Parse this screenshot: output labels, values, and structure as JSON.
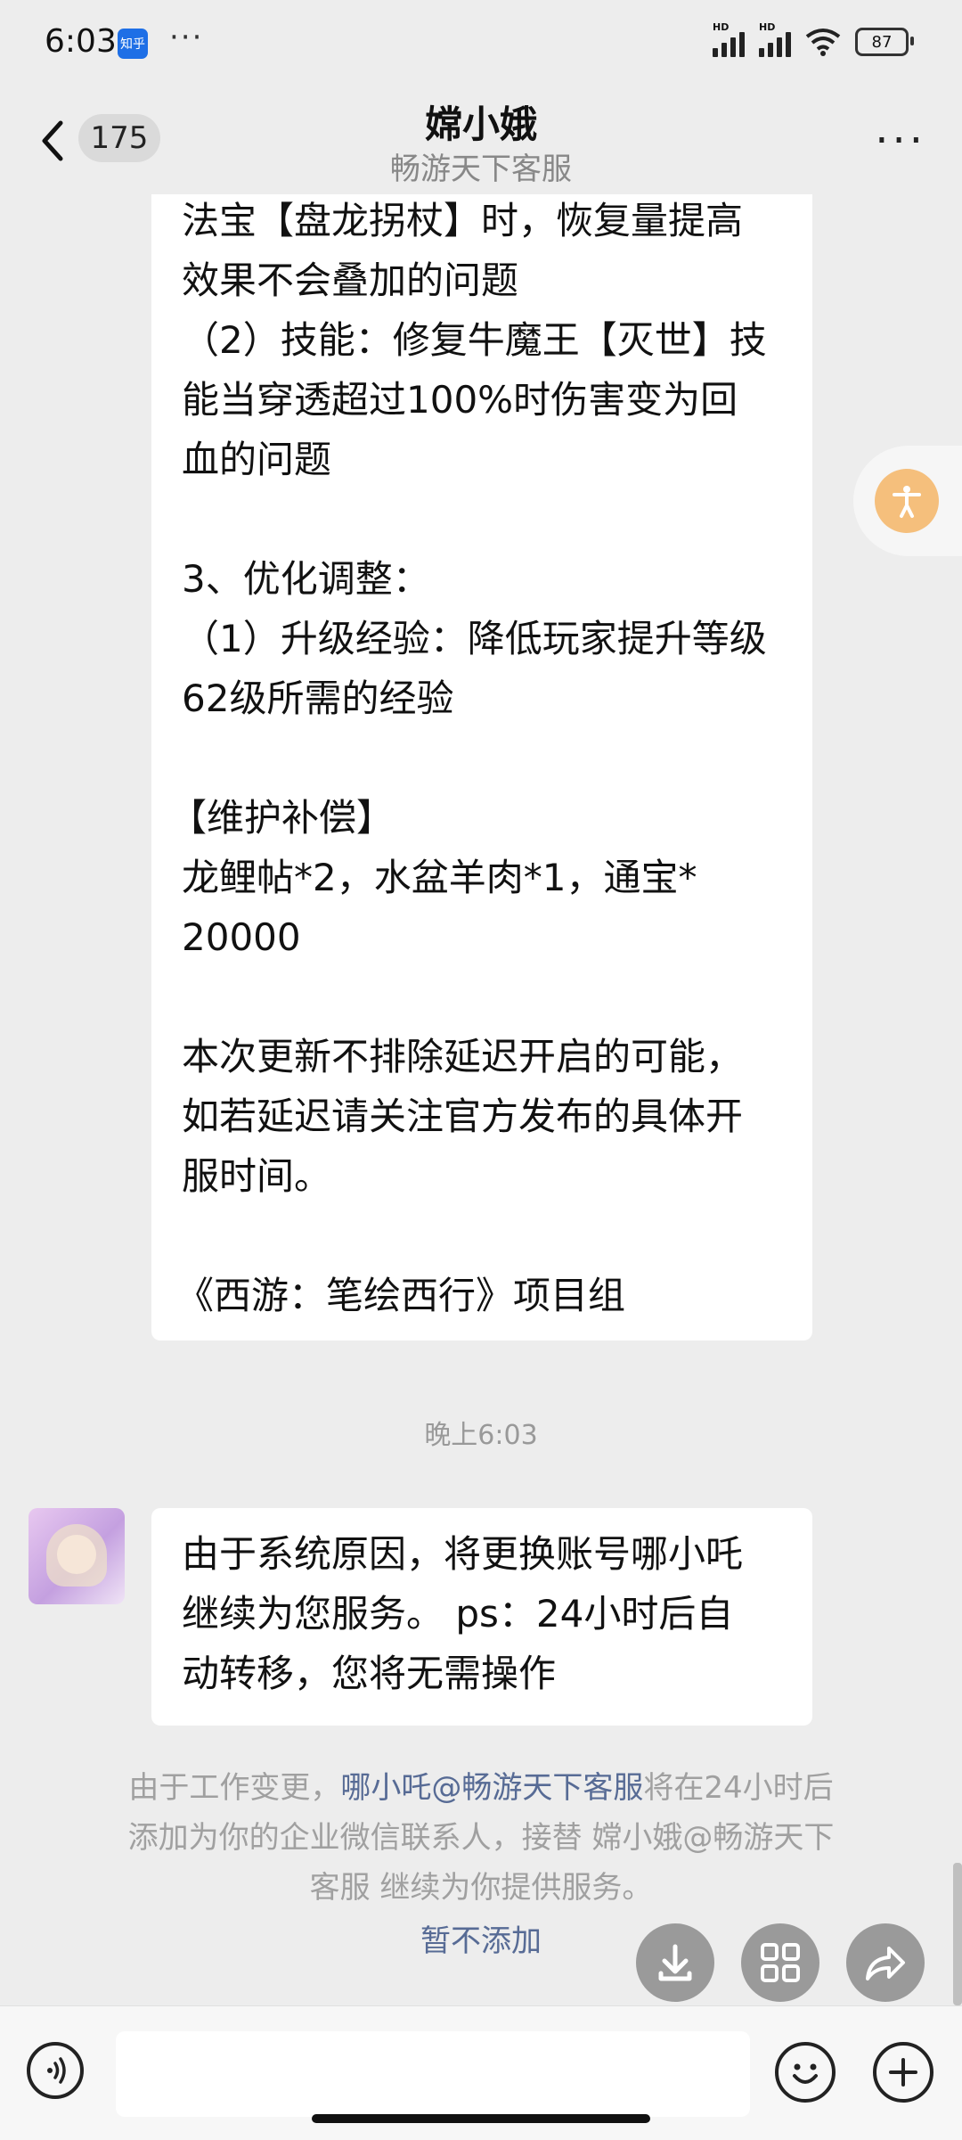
{
  "status_bar": {
    "time": "6:03",
    "app_badge": "知乎",
    "dots": "···",
    "hd": "HD",
    "battery": "87"
  },
  "header": {
    "back_count": "175",
    "title": "嫦小娥",
    "subtitle": "畅游天下客服",
    "more": "···"
  },
  "message1": {
    "lines": [
      "法宝【盘龙拐杖】时，恢复量提高",
      "效果不会叠加的问题",
      "（2）技能：修复牛魔王【灭世】技",
      "能当穿透超过100%时伤害变为回",
      "血的问题",
      "",
      "3、优化调整：",
      "（1）升级经验：降低玩家提升等级",
      "62级所需的经验",
      "",
      "【维护补偿】",
      "龙鲤帖*2，水盆羊肉*1，通宝*",
      "20000",
      "",
      "本次更新不排除延迟开启的可能，",
      "如若延迟请关注官方发布的具体开",
      "服时间。",
      "",
      "《西游：笔绘西行》项目组"
    ]
  },
  "time_label": "晚上6:03",
  "message2": {
    "lines": [
      "由于系统原因，将更换账号哪小吒",
      " 继续为您服务。 ps：24小时后自",
      "动转移，您将无需操作"
    ]
  },
  "notice": {
    "prefix": "由于工作变更，",
    "link": "哪小吒@畅游天下客服",
    "line1_suffix": "将在24小时后",
    "line2": "添加为你的企业微信联系人，接替 嫦小娥@畅游天下",
    "line3": "客服 继续为你提供服务。",
    "action": "暂不添加"
  },
  "icons": {
    "back": "chevron-left-icon",
    "accessibility": "accessibility-icon",
    "download": "download-icon",
    "grid": "grid-icon",
    "share": "share-icon",
    "voice": "voice-icon",
    "emoji": "emoji-icon",
    "plus": "plus-icon"
  },
  "colors": {
    "background": "#ededed",
    "bubble": "#ffffff",
    "link": "#576b95",
    "accessibility": "#f5bf7c"
  }
}
